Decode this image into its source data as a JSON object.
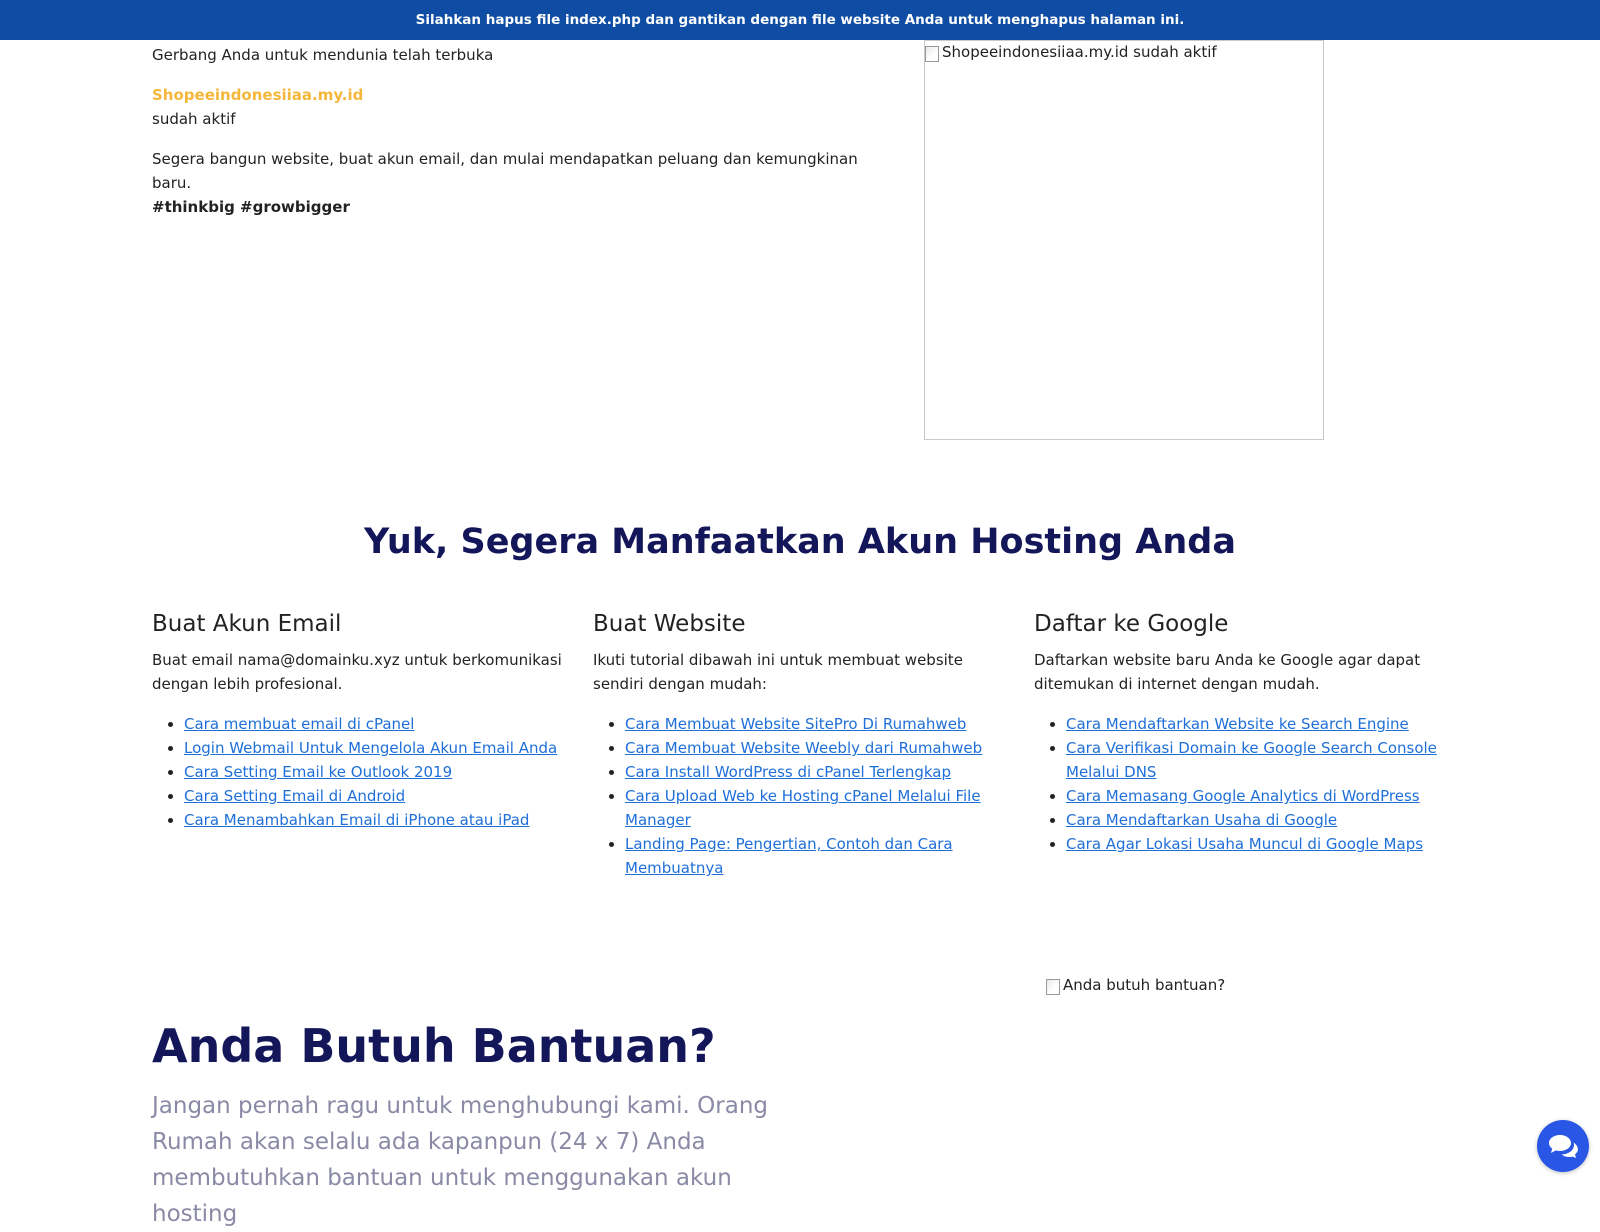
{
  "topbar": {
    "notice": "Silahkan hapus file index.php dan gantikan dengan file website Anda untuk menghapus halaman ini."
  },
  "hero": {
    "tagline": "Gerbang Anda untuk mendunia telah terbuka",
    "domain": "Shopeeindonesiiaa.my.id",
    "status": "sudah aktif",
    "description": "Segera bangun website, buat akun email, dan mulai mendapatkan peluang dan kemungkinan baru.",
    "hashtags": "#thinkbig #growbigger",
    "image_alt": "Shopeeindonesiiaa.my.id sudah aktif"
  },
  "section": {
    "title": "Yuk, Segera Manfaatkan Akun Hosting Anda"
  },
  "columns": [
    {
      "heading": "Buat Akun Email",
      "description": "Buat email nama@domainku.xyz untuk berkomunikasi dengan lebih profesional.",
      "links": [
        "Cara membuat email di cPanel",
        "Login Webmail Untuk Mengelola Akun Email Anda",
        "Cara Setting Email ke Outlook 2019",
        "Cara Setting Email di Android",
        "Cara Menambahkan Email di iPhone atau iPad"
      ]
    },
    {
      "heading": "Buat Website",
      "description": "Ikuti tutorial dibawah ini untuk membuat website sendiri dengan mudah:",
      "links": [
        "Cara Membuat Website SitePro Di Rumahweb",
        "Cara Membuat Website Weebly dari Rumahweb",
        "Cara Install WordPress di cPanel Terlengkap",
        "Cara Upload Web ke Hosting cPanel Melalui File Manager",
        "Landing Page: Pengertian, Contoh dan Cara Membuatnya"
      ]
    },
    {
      "heading": "Daftar ke Google",
      "description": "Daftarkan website baru Anda ke Google agar dapat ditemukan di internet dengan mudah.",
      "links": [
        "Cara Mendaftarkan Website ke Search Engine",
        "Cara Verifikasi Domain ke Google Search Console Melalui DNS",
        "Cara Memasang Google Analytics di WordPress",
        "Cara Mendaftarkan Usaha di Google",
        "Cara Agar Lokasi Usaha Muncul di Google Maps"
      ]
    }
  ],
  "help": {
    "title": "Anda Butuh Bantuan?",
    "text": "Jangan pernah ragu untuk menghubungi kami. Orang Rumah akan selalu ada kapanpun (24 x 7) Anda membutuhkan bantuan untuk menggunakan akun hosting",
    "image_alt": "Anda butuh bantuan?"
  },
  "icons": {
    "chat": "chat-bubbles-icon",
    "broken_image": "broken-image-icon"
  },
  "colors": {
    "topbar": "#0e4da3",
    "accent_domain": "#f4b73b",
    "heading_navy": "#14165a",
    "link": "#1e6fd9",
    "chat_button": "#2a56e6"
  }
}
